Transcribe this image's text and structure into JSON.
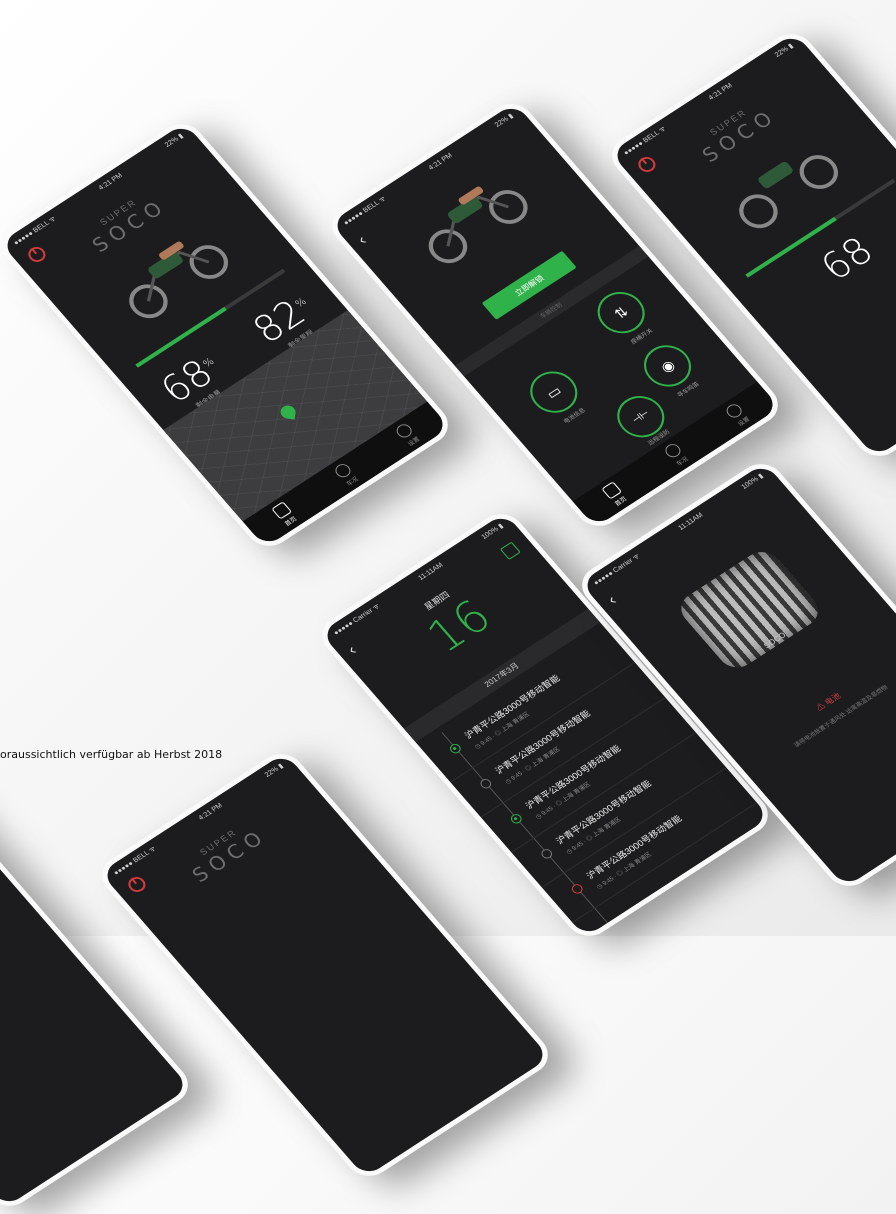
{
  "caption": "oraussichtlich verfügbar ab Herbst 2018",
  "colors": {
    "accent": "#2fb24a",
    "danger": "#d23b3b",
    "screen_bg": "#1c1c1e"
  },
  "phone_dashboard": {
    "status": {
      "carrier": "●●●●● BELL ᯤ",
      "time": "4:21 PM",
      "battery": "22% ▮"
    },
    "logo_line1": "SUPER",
    "logo_line2": "SOCO",
    "battery_progress": 0.6,
    "stat_left": {
      "value": "68",
      "unit": "%",
      "label": "剩余电量"
    },
    "stat_right": {
      "value": "82",
      "unit": "%",
      "label": "剩余里程"
    },
    "tabs": [
      "首页",
      "车况",
      "设置"
    ]
  },
  "phone_control": {
    "status": {
      "carrier": "●●●●● BELL ᯤ",
      "time": "4:21 PM",
      "battery": "22% ▮"
    },
    "button_label": "立即解锁",
    "divider_text": "车辆控制",
    "controls": [
      {
        "label": "座桶开关",
        "icon": "seat-icon",
        "glyph": "⇅"
      },
      {
        "label": "电池信息",
        "icon": "battery-icon",
        "glyph": "▭"
      },
      {
        "label": "寻车鸣笛",
        "icon": "eye-icon",
        "glyph": "◉"
      },
      {
        "label": "远程设防",
        "icon": "plug-icon",
        "glyph": "⊣⊢"
      }
    ],
    "tabs": [
      "首页",
      "车况",
      "设置"
    ]
  },
  "phone_trips": {
    "status": {
      "carrier": "●●●●● Carrier ᯤ",
      "time": "11:11AM",
      "battery": "100% ▮"
    },
    "weekday": "星期四",
    "day": "16",
    "month": "2017年3月",
    "trips": [
      {
        "title": "沪青平公路3000号移动智能",
        "meta": "◷ 9:45 · ◎ 上海 青浦区"
      },
      {
        "title": "沪青平公路3000号移动智能",
        "meta": "◷ 9:45 · ◎ 上海 青浦区"
      },
      {
        "title": "沪青平公路3000号移动智能",
        "meta": "◷ 9:45 · ◎ 上海 青浦区"
      },
      {
        "title": "沪青平公路3000号移动智能",
        "meta": "◷ 9:45 · ◎ 上海 青浦区"
      },
      {
        "title": "沪青平公路3000号移动智能",
        "meta": "◷ 9:45 · ◎ 上海 青浦区"
      }
    ]
  },
  "phone_battery": {
    "status": {
      "carrier": "●●●●● Carrier ᯤ",
      "time": "11:11AM",
      "battery": "100% ▮"
    },
    "brand": "SOCO",
    "warning": "⚠ 电池",
    "warning_text": "请将电池放置于通风处 远离高温及易燃物"
  },
  "phone_dashboard_right": {
    "status": {
      "carrier": "●●●●● BELL ᯤ",
      "time": "4:21 PM",
      "battery": "22% ▮"
    },
    "logo_line1": "SUPER",
    "logo_line2": "SOCO",
    "stat_value": "68"
  },
  "phone_dashboard_bottom": {
    "status": {
      "carrier": "●●●●● BELL ᯤ",
      "time": "4:21 PM",
      "battery": "22% ▮"
    },
    "logo_line1": "SUPER",
    "logo_line2": "SOCO"
  }
}
